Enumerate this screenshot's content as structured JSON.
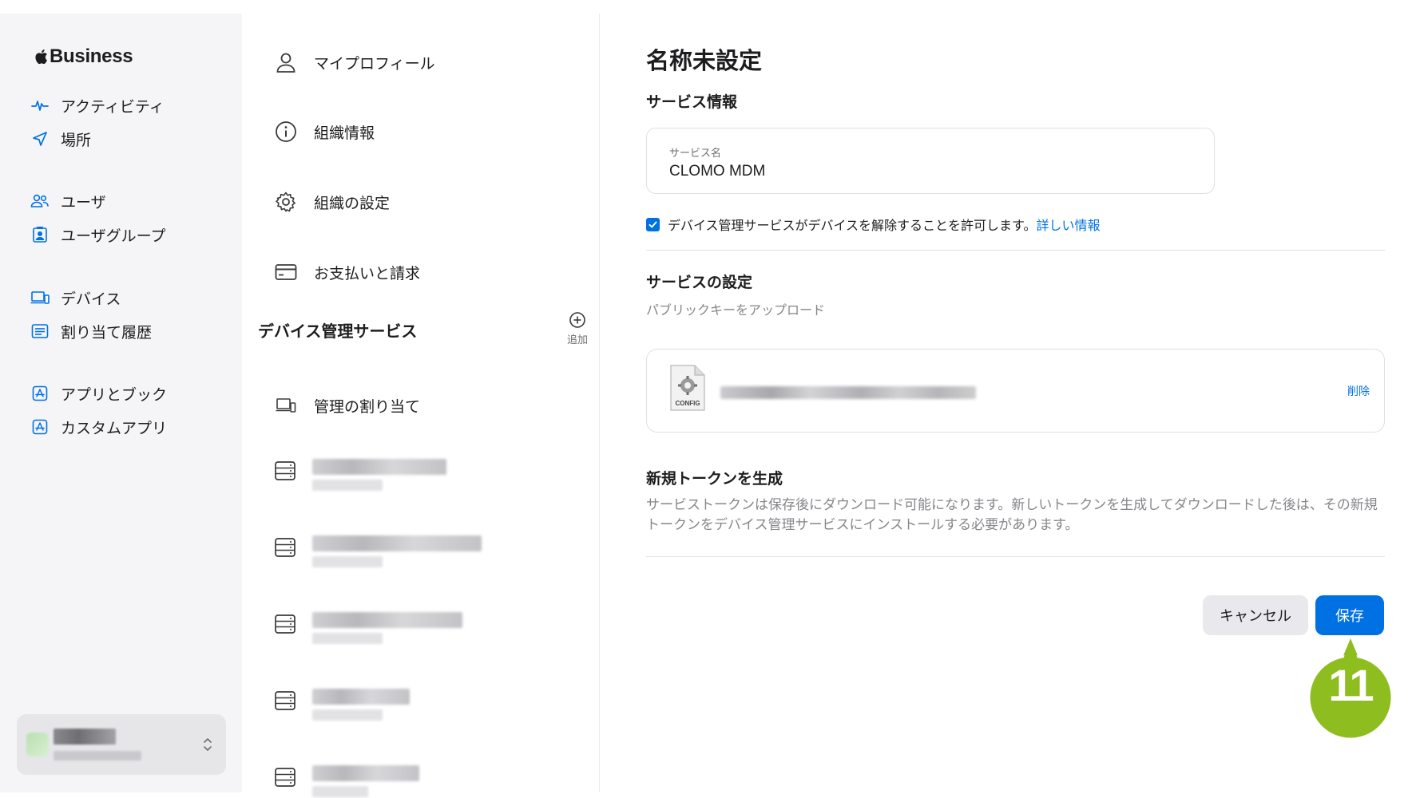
{
  "brand": {
    "name": "Business"
  },
  "sidebar": {
    "items": [
      {
        "label": "アクティビティ",
        "icon": "activity-icon"
      },
      {
        "label": "場所",
        "icon": "location-arrow-icon"
      },
      {
        "label": "ユーザ",
        "icon": "users-icon"
      },
      {
        "label": "ユーザグループ",
        "icon": "user-group-icon"
      },
      {
        "label": "デバイス",
        "icon": "devices-icon"
      },
      {
        "label": "割り当て履歴",
        "icon": "assignment-history-icon"
      },
      {
        "label": "アプリとブック",
        "icon": "app-store-icon"
      },
      {
        "label": "カスタムアプリ",
        "icon": "custom-app-icon"
      }
    ]
  },
  "settings": {
    "items": [
      {
        "label": "マイプロフィール",
        "icon": "person-icon"
      },
      {
        "label": "組織情報",
        "icon": "info-icon"
      },
      {
        "label": "組織の設定",
        "icon": "gear-icon"
      },
      {
        "label": "お支払いと請求",
        "icon": "credit-card-icon"
      }
    ],
    "device_mgmt": {
      "title": "デバイス管理サービス",
      "add_label": "追加",
      "assignment_label": "管理の割り当て"
    }
  },
  "detail": {
    "title": "名称未設定",
    "service_info_heading": "サービス情報",
    "service_name_label": "サービス名",
    "service_name_value": "CLOMO MDM",
    "release_permission_text": "デバイス管理サービスがデバイスを解除することを許可します。",
    "release_permission_link": "詳しい情報",
    "release_permission_checked": true,
    "service_settings_heading": "サービスの設定",
    "upload_hint": "パブリックキーをアップロード",
    "file_icon_label": "CONFIG",
    "delete_label": "削除",
    "token_title": "新規トークンを生成",
    "token_description": "サービストークンは保存後にダウンロード可能になります。新しいトークンを生成してダウンロードした後は、その新規トークンをデバイス管理サービスにインストールする必要があります。",
    "cancel_label": "キャンセル",
    "save_label": "保存"
  },
  "callout": {
    "number": "11",
    "color": "#8dbd1e"
  },
  "colors": {
    "accent": "#0071e3",
    "sidebar_bg": "#f5f5f7",
    "text": "#1d1d1f",
    "muted": "#86868b"
  }
}
